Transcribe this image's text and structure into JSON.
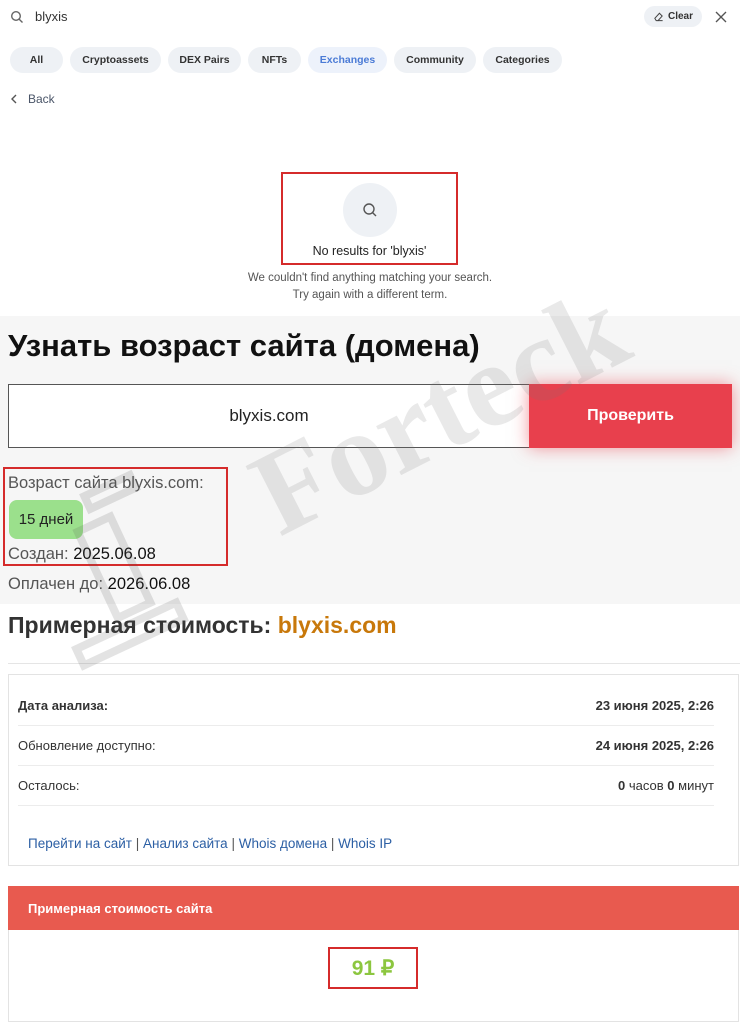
{
  "search": {
    "query": "blyxis",
    "clear_label": "Clear",
    "tabs": [
      {
        "label": "All",
        "active": false
      },
      {
        "label": "Cryptoassets",
        "active": false
      },
      {
        "label": "DEX Pairs",
        "active": false
      },
      {
        "label": "NFTs",
        "active": false
      },
      {
        "label": "Exchanges",
        "active": true
      },
      {
        "label": "Community",
        "active": false
      },
      {
        "label": "Categories",
        "active": false
      }
    ],
    "back_label": "Back",
    "empty": {
      "title": "No results for 'blyxis'",
      "line1": "We couldn't find anything matching your search.",
      "line2": "Try again with a different term."
    }
  },
  "age_checker": {
    "title": "Узнать возраст сайта (домена)",
    "input_value": "blyxis.com",
    "button_label": "Проверить",
    "age_label": "Возраст сайта blyxis.com:",
    "age_value": "15 дней",
    "created_label": "Создан:",
    "created_value": "2025.06.08",
    "paid_label": "Оплачен до:",
    "paid_value": "2026.06.08"
  },
  "cost": {
    "title": "Примерная стоимость:",
    "domain": "blyxis.com",
    "rows": [
      {
        "label": "Дата анализа:",
        "value": "23 июня 2025, 2:26"
      },
      {
        "label": "Обновление доступно:",
        "value": "24 июня 2025, 2:26"
      },
      {
        "label": "Осталось:",
        "hours": "0",
        "hours_unit": "часов",
        "minutes": "0",
        "minutes_unit": "минут"
      }
    ],
    "links": [
      "Перейти на сайт",
      "Анализ сайта",
      "Whois домена",
      "Whois IP"
    ],
    "link_separator": "|",
    "price_header": "Примерная стоимость сайта",
    "price_value": "91 ₽"
  },
  "watermark": "Forteck",
  "colors": {
    "accent_red": "#e8404d",
    "price_header": "#e85a4f",
    "price_green": "#8cc63f",
    "badge_green": "#9be08c",
    "domain_orange": "#c8780a",
    "link_blue": "#2c5fa4",
    "highlight_border": "#d52b2b"
  }
}
